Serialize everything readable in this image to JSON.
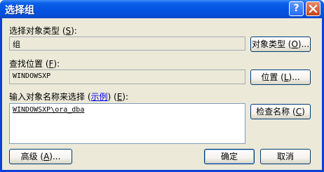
{
  "window": {
    "title": "选择组",
    "help_glyph": "?"
  },
  "object_type": {
    "label_prefix": "选择对象类型 (",
    "label_key": "S",
    "label_suffix": "):",
    "value": "组",
    "button_prefix": "对象类型 (",
    "button_key": "O",
    "button_suffix": ")..."
  },
  "location": {
    "label_prefix": "查找位置 (",
    "label_key": "F",
    "label_suffix": "):",
    "value": "WINDOWSXP",
    "button_prefix": "位置 (",
    "button_key": "L",
    "button_suffix": ")..."
  },
  "object_names": {
    "label_prefix": "输入对象名称来选择 (",
    "label_link": "示例",
    "label_middle": ") (",
    "label_key": "E",
    "label_suffix": "):",
    "value": "WINDOWSXP\\ora_dba",
    "button_prefix": "检查名称 (",
    "button_key": "C",
    "button_suffix": ")"
  },
  "footer": {
    "advanced_prefix": "高级 (",
    "advanced_key": "A",
    "advanced_suffix": ")...",
    "ok_label": "确定",
    "cancel_label": "取消"
  }
}
